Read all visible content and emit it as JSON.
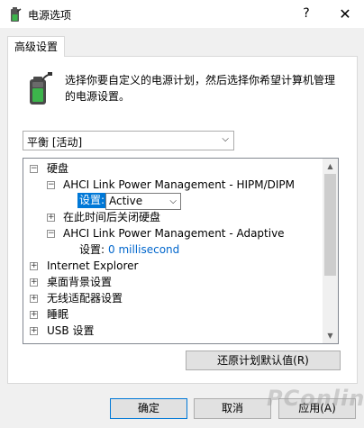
{
  "window": {
    "title": "电源选项",
    "help_glyph": "?",
    "close_glyph": "✕"
  },
  "tab": {
    "label": "高级设置"
  },
  "description": {
    "line1": "选择你要自定义的电源计划，然后选择你希望计算机管理",
    "line2": "的电源设置。"
  },
  "plan_select": {
    "value": "平衡 [活动]"
  },
  "tree": {
    "items": [
      {
        "label": "硬盘",
        "expander": "⊟"
      },
      {
        "label": "AHCI Link Power Management - HIPM/DIPM",
        "expander": "⊟"
      },
      {
        "setting_label": "设置:",
        "setting_value": "Active"
      },
      {
        "label": "在此时间后关闭硬盘",
        "expander": "⊞"
      },
      {
        "label": "AHCI Link Power Management - Adaptive",
        "expander": "⊟"
      },
      {
        "setting_label": "设置:",
        "setting_value": "0 millisecond"
      },
      {
        "label": "Internet Explorer",
        "expander": "⊞"
      },
      {
        "label": "桌面背景设置",
        "expander": "⊞"
      },
      {
        "label": "无线适配器设置",
        "expander": "⊞"
      },
      {
        "label": "睡眠",
        "expander": "⊞"
      },
      {
        "label": "USB 设置",
        "expander": "⊞"
      }
    ]
  },
  "buttons": {
    "restore": "还原计划默认值(R)",
    "ok": "确定",
    "cancel": "取消",
    "apply": "应用(A)"
  },
  "watermark": {
    "text": "PConline"
  },
  "colors": {
    "selection": "#0078d7",
    "link": "#0066cc",
    "battery_green": "#3cb44b"
  }
}
